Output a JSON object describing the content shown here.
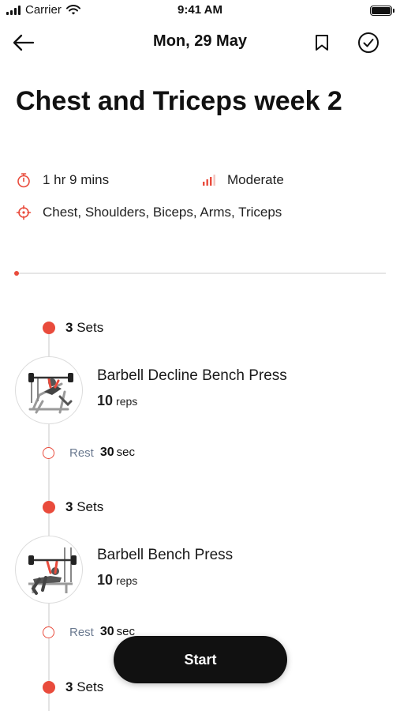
{
  "status_bar": {
    "carrier": "Carrier",
    "time": "9:41 AM",
    "icons": [
      "signal-icon",
      "wifi-icon",
      "battery-icon"
    ]
  },
  "nav": {
    "date": "Mon, 29 May",
    "icons": [
      "back-arrow-icon",
      "bookmark-icon",
      "check-circle-icon"
    ]
  },
  "workout": {
    "title": "Chest and Triceps week 2",
    "duration": "1 hr 9 mins",
    "intensity": "Moderate",
    "muscles": "Chest, Shoulders, Biceps, Arms, Triceps",
    "progress_fraction": 0
  },
  "blocks": [
    {
      "sets_count": "3",
      "sets_label": "Sets",
      "exercise": {
        "name": "Barbell Decline Bench Press",
        "reps_value": "10",
        "reps_unit": "reps"
      },
      "rest": {
        "label": "Rest",
        "value": "30",
        "unit": "sec"
      }
    },
    {
      "sets_count": "3",
      "sets_label": "Sets",
      "exercise": {
        "name": "Barbell Bench Press",
        "reps_value": "10",
        "reps_unit": "reps"
      },
      "rest": {
        "label": "Rest",
        "value": "30",
        "unit": "sec"
      }
    },
    {
      "sets_count": "3",
      "sets_label": "Sets"
    }
  ],
  "start_button": {
    "label": "Start"
  },
  "colors": {
    "accent": "#e94b3c",
    "text": "#111111",
    "muted": "#6b7a90",
    "button": "#111111"
  }
}
